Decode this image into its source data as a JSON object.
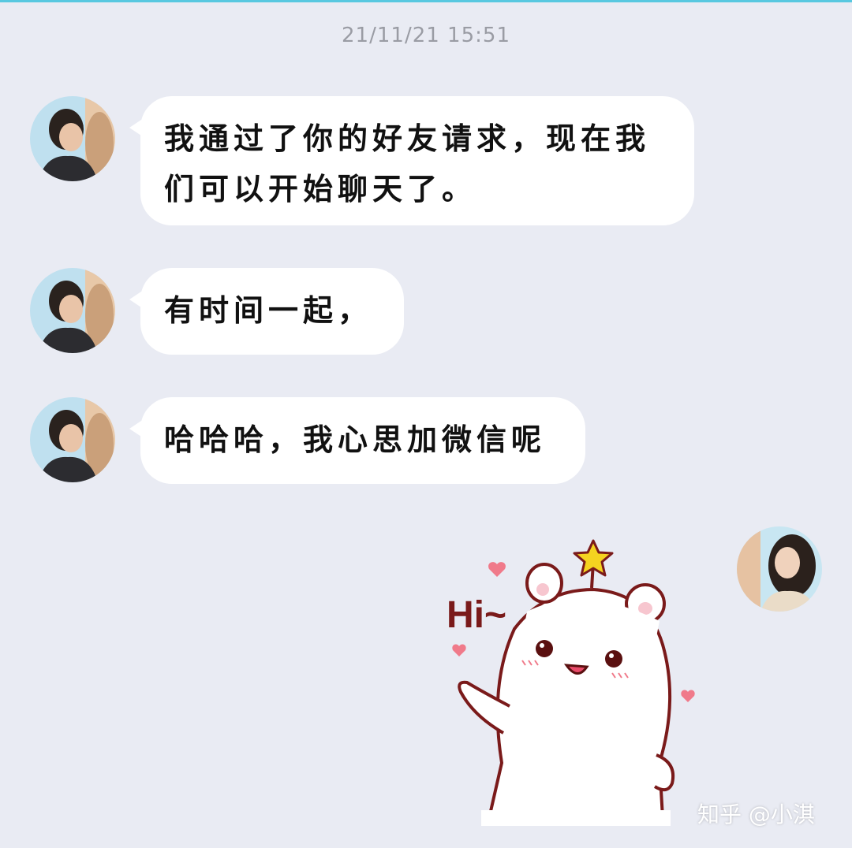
{
  "timestamp": "21/11/21 15:51",
  "messages": [
    {
      "side": "left",
      "text": "我通过了你的好友请求，现在我们可以开始聊天了。"
    },
    {
      "side": "left",
      "text": "有时间一起，"
    },
    {
      "side": "left",
      "text": "哈哈哈，我心思加微信呢"
    }
  ],
  "sticker": {
    "text": "Hi~",
    "icon": "bear-waving-sticker"
  },
  "watermark": "知乎 @小淇",
  "colors": {
    "background": "#e9ebf3",
    "bubble": "#ffffff",
    "accent_line": "#58c8e0",
    "sticker_outline": "#7a1a1a",
    "star": "#f5d320",
    "heart": "#f07a8a"
  }
}
